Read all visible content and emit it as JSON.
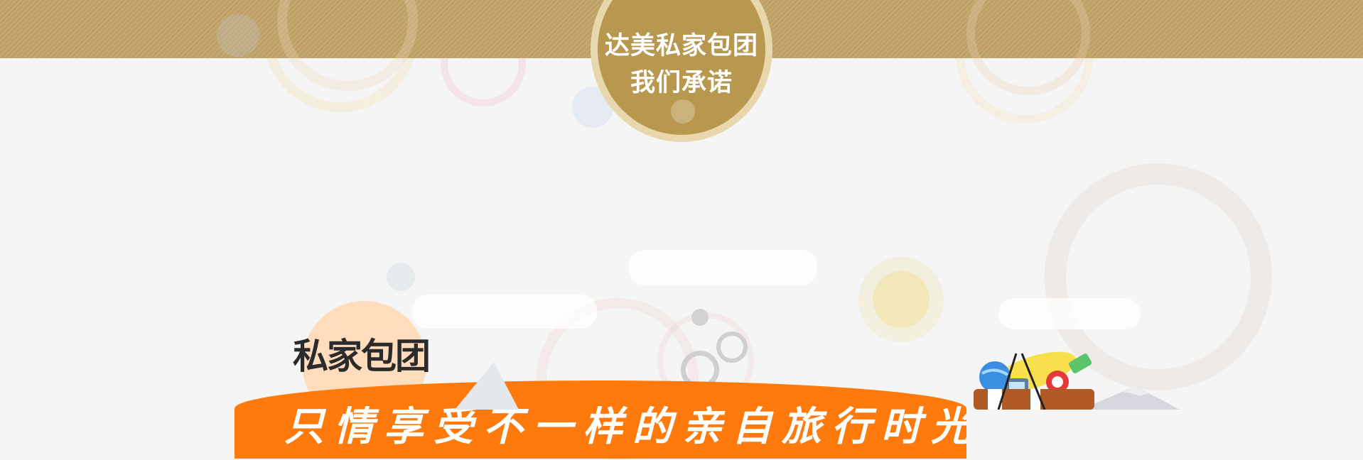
{
  "promise_badge": {
    "line1": "达美私家包团",
    "line2": "我们承诺"
  },
  "section": {
    "title": "私家包团",
    "banner_text": "只情享受不一样的亲自旅行时光"
  },
  "colors": {
    "gold_band": "#c2a569",
    "badge_ring": "#e8d6ad",
    "badge_fill": "#b8984f",
    "banner_orange": "#ff7a0c",
    "title_dark": "#2b2b2b",
    "background": "#f5f5f5"
  },
  "icons": {
    "travel_illustration": "suitcase-with-globe-camera-surfboard-icon"
  }
}
